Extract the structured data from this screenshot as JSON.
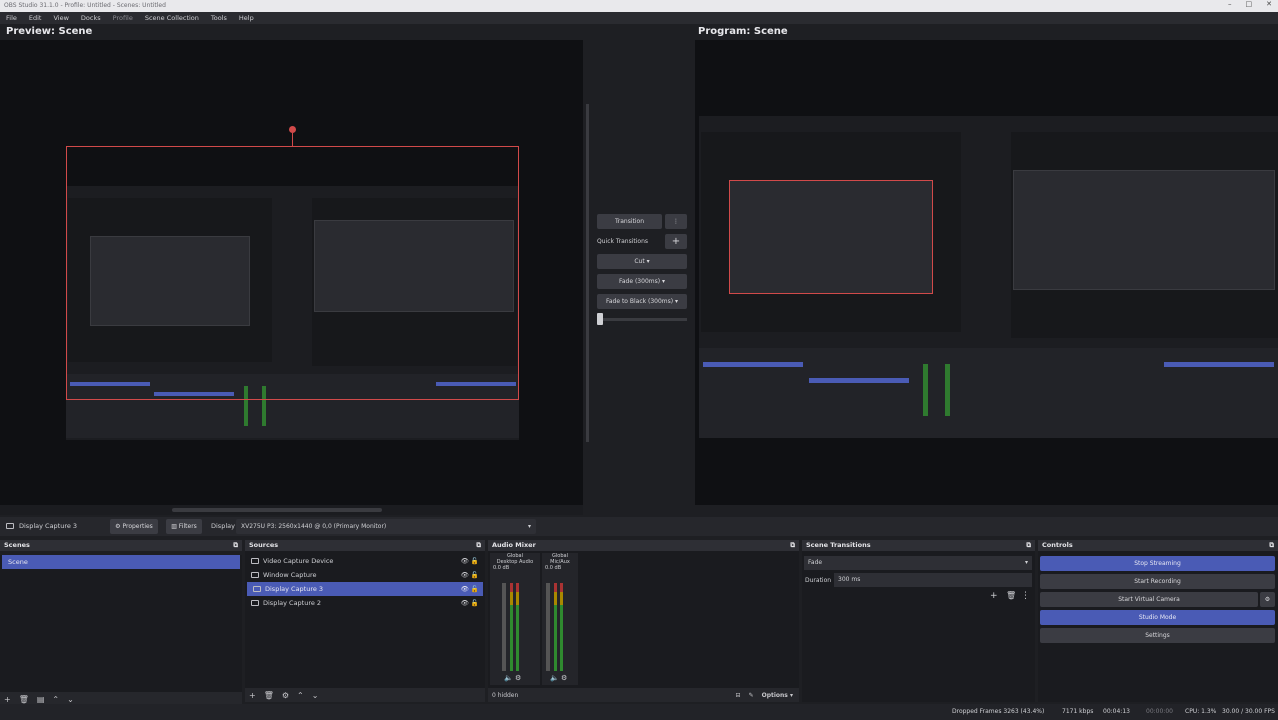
{
  "window": {
    "title": "OBS Studio 31.1.0 - Profile: Untitled - Scenes: Untitled",
    "controls": [
      "–",
      "□",
      "✕"
    ]
  },
  "menu": [
    "File",
    "Edit",
    "View",
    "Docks",
    "Profile",
    "Scene Collection",
    "Tools",
    "Help"
  ],
  "preview": {
    "label": "Preview: Scene"
  },
  "program": {
    "label": "Program: Scene"
  },
  "transition_panel": {
    "transition_btn": "Transition",
    "quick_label": "Quick Transitions",
    "cut": "Cut",
    "fade": "Fade (300ms)",
    "fade_black": "Fade to Black (300ms)"
  },
  "source_toolbar": {
    "source_name": "Display Capture 3",
    "properties": "Properties",
    "filters": "Filters",
    "display_label": "Display",
    "display_value": "XV275U P3: 2560x1440 @ 0,0 (Primary Monitor)"
  },
  "scenes": {
    "title": "Scenes",
    "items": [
      "Scene"
    ]
  },
  "sources": {
    "title": "Sources",
    "items": [
      {
        "name": "Video Capture Device",
        "icon": "camera-icon"
      },
      {
        "name": "Window Capture",
        "icon": "window-icon"
      },
      {
        "name": "Display Capture 3",
        "icon": "monitor-icon",
        "selected": true
      },
      {
        "name": "Display Capture 2",
        "icon": "monitor-icon"
      }
    ]
  },
  "audio": {
    "title": "Audio Mixer",
    "channels": [
      {
        "scope": "Global",
        "name": "Desktop Audio",
        "db": "0.0 dB"
      },
      {
        "scope": "Global",
        "name": "Mic/Aux",
        "db": "0.0 dB"
      }
    ],
    "hidden": "0 hidden",
    "options": "Options"
  },
  "scene_transitions": {
    "title": "Scene Transitions",
    "transition": "Fade",
    "duration_label": "Duration",
    "duration_value": "300 ms"
  },
  "controls": {
    "title": "Controls",
    "stop_streaming": "Stop Streaming",
    "start_recording": "Start Recording",
    "start_virtual_camera": "Start Virtual Camera",
    "studio_mode": "Studio Mode",
    "settings": "Settings"
  },
  "status": {
    "dropped": "Dropped Frames 3263 (43.4%)",
    "bitrate": "7171 kbps",
    "stream_time": "00:04:13",
    "rec_time": "00:00:00",
    "cpu": "CPU: 1.3%",
    "fps": "30.00 / 30.00 FPS"
  },
  "colors": {
    "accent": "#4a5bb5",
    "selection": "#d14a4a",
    "background": "#1e1f23"
  }
}
